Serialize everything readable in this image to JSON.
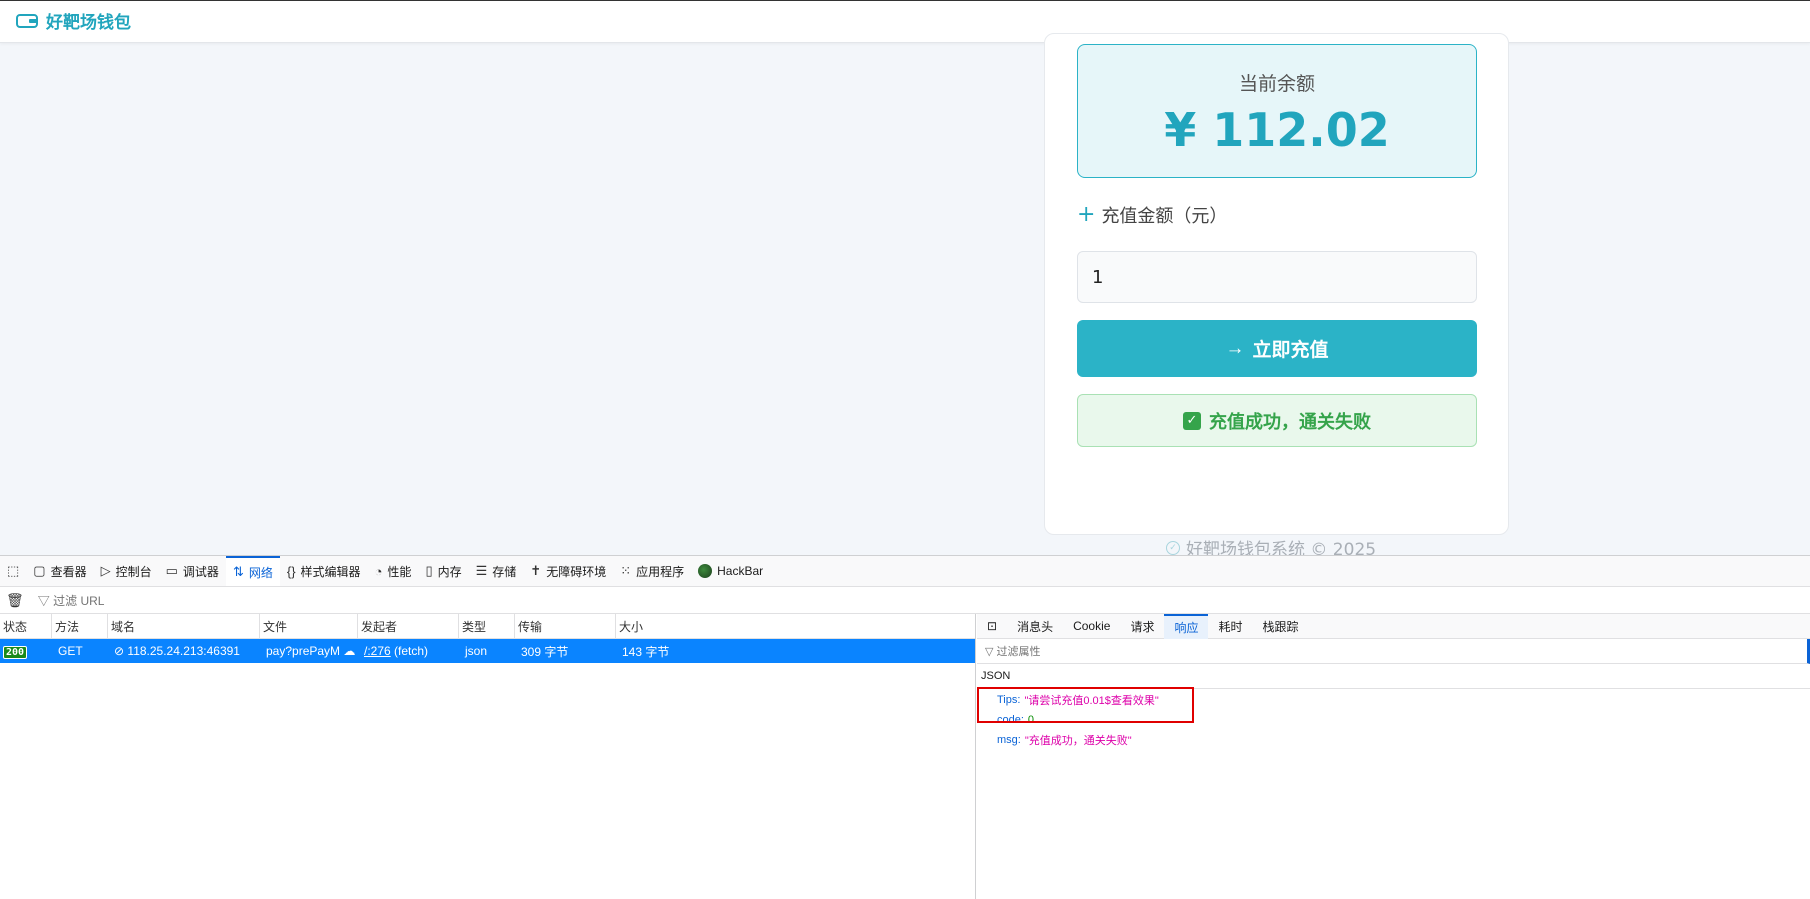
{
  "app": {
    "brand": "好靶场钱包",
    "brand_icon": "wallet-icon"
  },
  "balance": {
    "label": "当前余额",
    "value": "¥ 112.02"
  },
  "recharge": {
    "label": "充值金额（元）",
    "input_value": "1",
    "button_label": "立即充值",
    "result": "充值成功，通关失败"
  },
  "footer": {
    "text": "好靶场钱包系统 © 2025"
  },
  "devtools": {
    "tools": [
      {
        "label": "查看器",
        "icon": "inspector-icon"
      },
      {
        "label": "控制台",
        "icon": "console-icon"
      },
      {
        "label": "调试器",
        "icon": "debugger-icon"
      },
      {
        "label": "网络",
        "icon": "network-icon"
      },
      {
        "label": "样式编辑器",
        "icon": "style-editor-icon"
      },
      {
        "label": "性能",
        "icon": "performance-icon"
      },
      {
        "label": "内存",
        "icon": "memory-icon"
      },
      {
        "label": "存储",
        "icon": "storage-icon"
      },
      {
        "label": "无障碍环境",
        "icon": "accessibility-icon"
      },
      {
        "label": "应用程序",
        "icon": "application-icon"
      },
      {
        "label": "HackBar",
        "icon": "hackbar-icon"
      }
    ],
    "active_tool": "网络",
    "filter_placeholder": "过滤 URL",
    "columns": [
      "状态",
      "方法",
      "域名",
      "文件",
      "发起者",
      "类型",
      "传输",
      "大小"
    ],
    "request": {
      "status": "200",
      "method": "GET",
      "domain": "118.25.24.213:46391",
      "file": "pay?prePayM",
      "initiator": "/:276",
      "initiator_suffix": "(fetch)",
      "type": "json",
      "transferred": "309 字节",
      "size": "143 字节"
    },
    "panel_tabs": [
      "消息头",
      "Cookie",
      "请求",
      "响应",
      "耗时",
      "栈跟踪"
    ],
    "active_panel_tab": "响应",
    "property_filter": "过滤属性",
    "json_label": "JSON",
    "json": {
      "tips_key": "Tips:",
      "tips_value": "\"请尝试充值0.01$查看效果\"",
      "code_key": "code:",
      "code_value": "0",
      "msg_key": "msg:",
      "msg_value": "\"充值成功，通关失败\""
    }
  },
  "colors": {
    "accent": "#2bb3c7",
    "brand": "#21a5bd",
    "success": "#35a44b",
    "devtools_selected": "#0a84ff",
    "highlight": "#e00000"
  }
}
